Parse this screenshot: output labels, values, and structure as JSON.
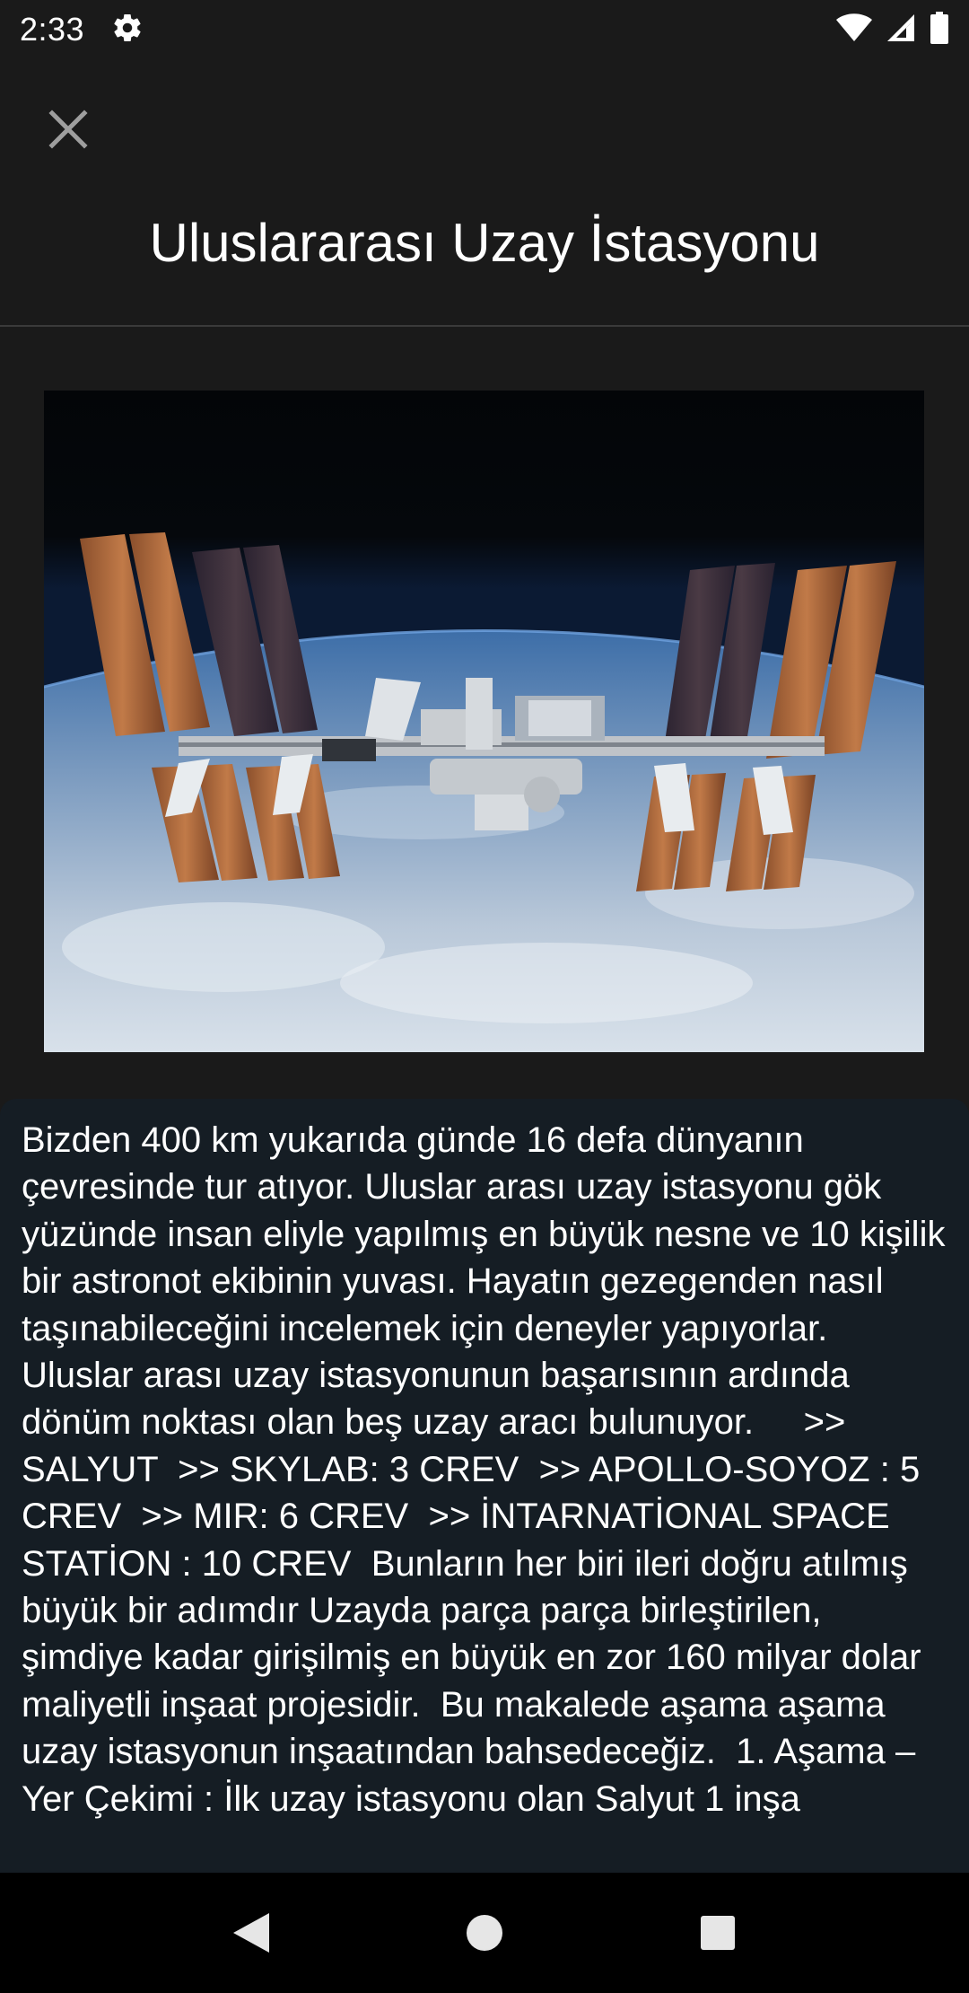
{
  "status_bar": {
    "time": "2:33",
    "icons": [
      "gear-icon",
      "wifi-icon",
      "signal-icon",
      "battery-icon"
    ]
  },
  "header": {
    "title": "Uluslararası Uzay İstasyonu",
    "close_icon": "close-icon"
  },
  "hero_image": {
    "subject": "international-space-station-over-earth"
  },
  "article": {
    "body": "Bizden 400 km yukarıda günde 16 defa dünyanın çevresinde tur atıyor. Uluslar arası uzay istasyonu gök yüzünde insan eliyle yapılmış en büyük nesne ve 10 kişilik bir astronot ekibinin yuvası. Hayatın gezegenden nasıl taşınabileceğini incelemek için deneyler yapıyorlar.  Uluslar arası uzay istasyonunun başarısının ardında dönüm noktası olan beş uzay aracı bulunuyor.     >> SALYUT  >> SKYLAB: 3 CREV  >> APOLLO-SOYOZ : 5 CREV  >> MIR: 6 CREV  >> İNTARNATİONAL SPACE STATİON : 10 CREV  Bunların her biri ileri doğru atılmış büyük bir adımdır Uzayda parça parça birleştirilen, şimdiye kadar girişilmiş en büyük en zor 160 milyar dolar maliyetli inşaat projesidir.  Bu makalede aşama aşama uzay istasyonun inşaatından bahsedeceğiz.  1. Aşama – Yer Çekimi : İlk uzay istasyonu olan Salyut 1 inşa"
  },
  "nav_bar": {
    "icons": [
      "back-icon",
      "home-icon",
      "recents-icon"
    ]
  },
  "colors": {
    "background": "#1a1a1a",
    "article_background": "#151d24",
    "text": "#ffffff",
    "divider": "#3a3a3a"
  }
}
